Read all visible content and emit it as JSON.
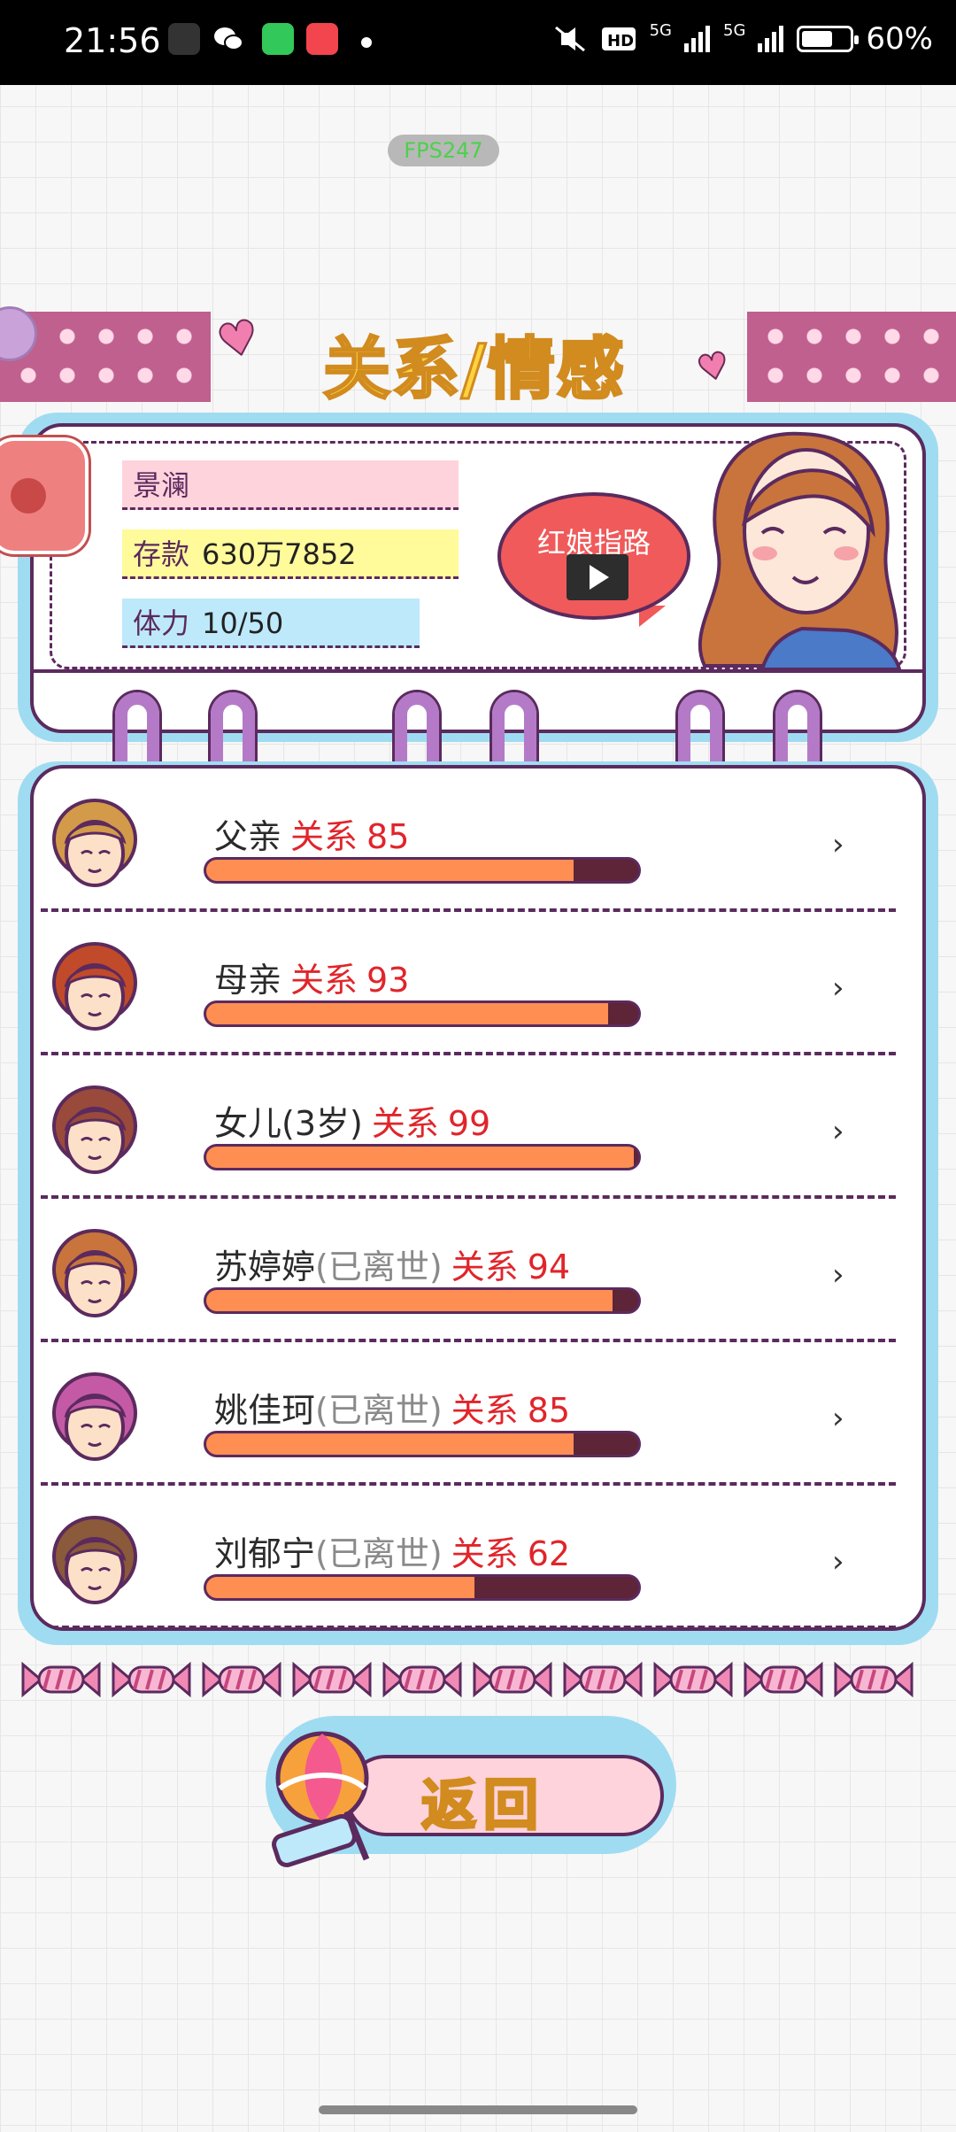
{
  "status_bar": {
    "time": "21:56",
    "network_1": "5G",
    "network_2": "5G",
    "battery": "60%",
    "icons": [
      "app-icon",
      "wechat-icon",
      "sms-icon",
      "music-icon",
      "mute-icon",
      "hd-icon",
      "signal-icon",
      "signal-icon",
      "battery-icon"
    ]
  },
  "fps": "FPS247",
  "title": "关系/情感",
  "profile": {
    "name": "景澜",
    "money_label": "存款",
    "money_value": "630万7852",
    "stamina_label": "体力",
    "stamina_value": "10/50",
    "matchmaker_label": "红娘指路"
  },
  "relationships": [
    {
      "name": "父亲",
      "deceased_note": "",
      "relation_label": "关系",
      "relation_value": "85",
      "level": 0.85,
      "avatar": "father-avatar",
      "hair": "#d39a4a"
    },
    {
      "name": "母亲",
      "deceased_note": "",
      "relation_label": "关系",
      "relation_value": "93",
      "level": 0.93,
      "avatar": "mother-avatar",
      "hair": "#c14a2a"
    },
    {
      "name": "女儿(3岁)",
      "deceased_note": "",
      "relation_label": "关系",
      "relation_value": "99",
      "level": 0.99,
      "avatar": "daughter-avatar",
      "hair": "#9a4a3a"
    },
    {
      "name": "苏婷婷",
      "deceased_note": "(已离世)",
      "relation_label": "关系",
      "relation_value": "94",
      "level": 0.94,
      "avatar": "woman-avatar",
      "hair": "#c8743c"
    },
    {
      "name": "姚佳珂",
      "deceased_note": "(已离世)",
      "relation_label": "关系",
      "relation_value": "85",
      "level": 0.85,
      "avatar": "woman-curly-avatar",
      "hair": "#c45aa6"
    },
    {
      "name": "刘郁宁",
      "deceased_note": "(已离世)",
      "relation_label": "关系",
      "relation_value": "62",
      "level": 0.62,
      "avatar": "man-avatar",
      "hair": "#8a5a3a"
    }
  ],
  "back_label": "返回",
  "colors": {
    "accent_yellow": "#ffd23f",
    "outline_purple": "#5b2a5e",
    "bar_fill": "#ff8e53",
    "relation_red": "#e0252b",
    "panel_blue": "#9fdcf1"
  }
}
